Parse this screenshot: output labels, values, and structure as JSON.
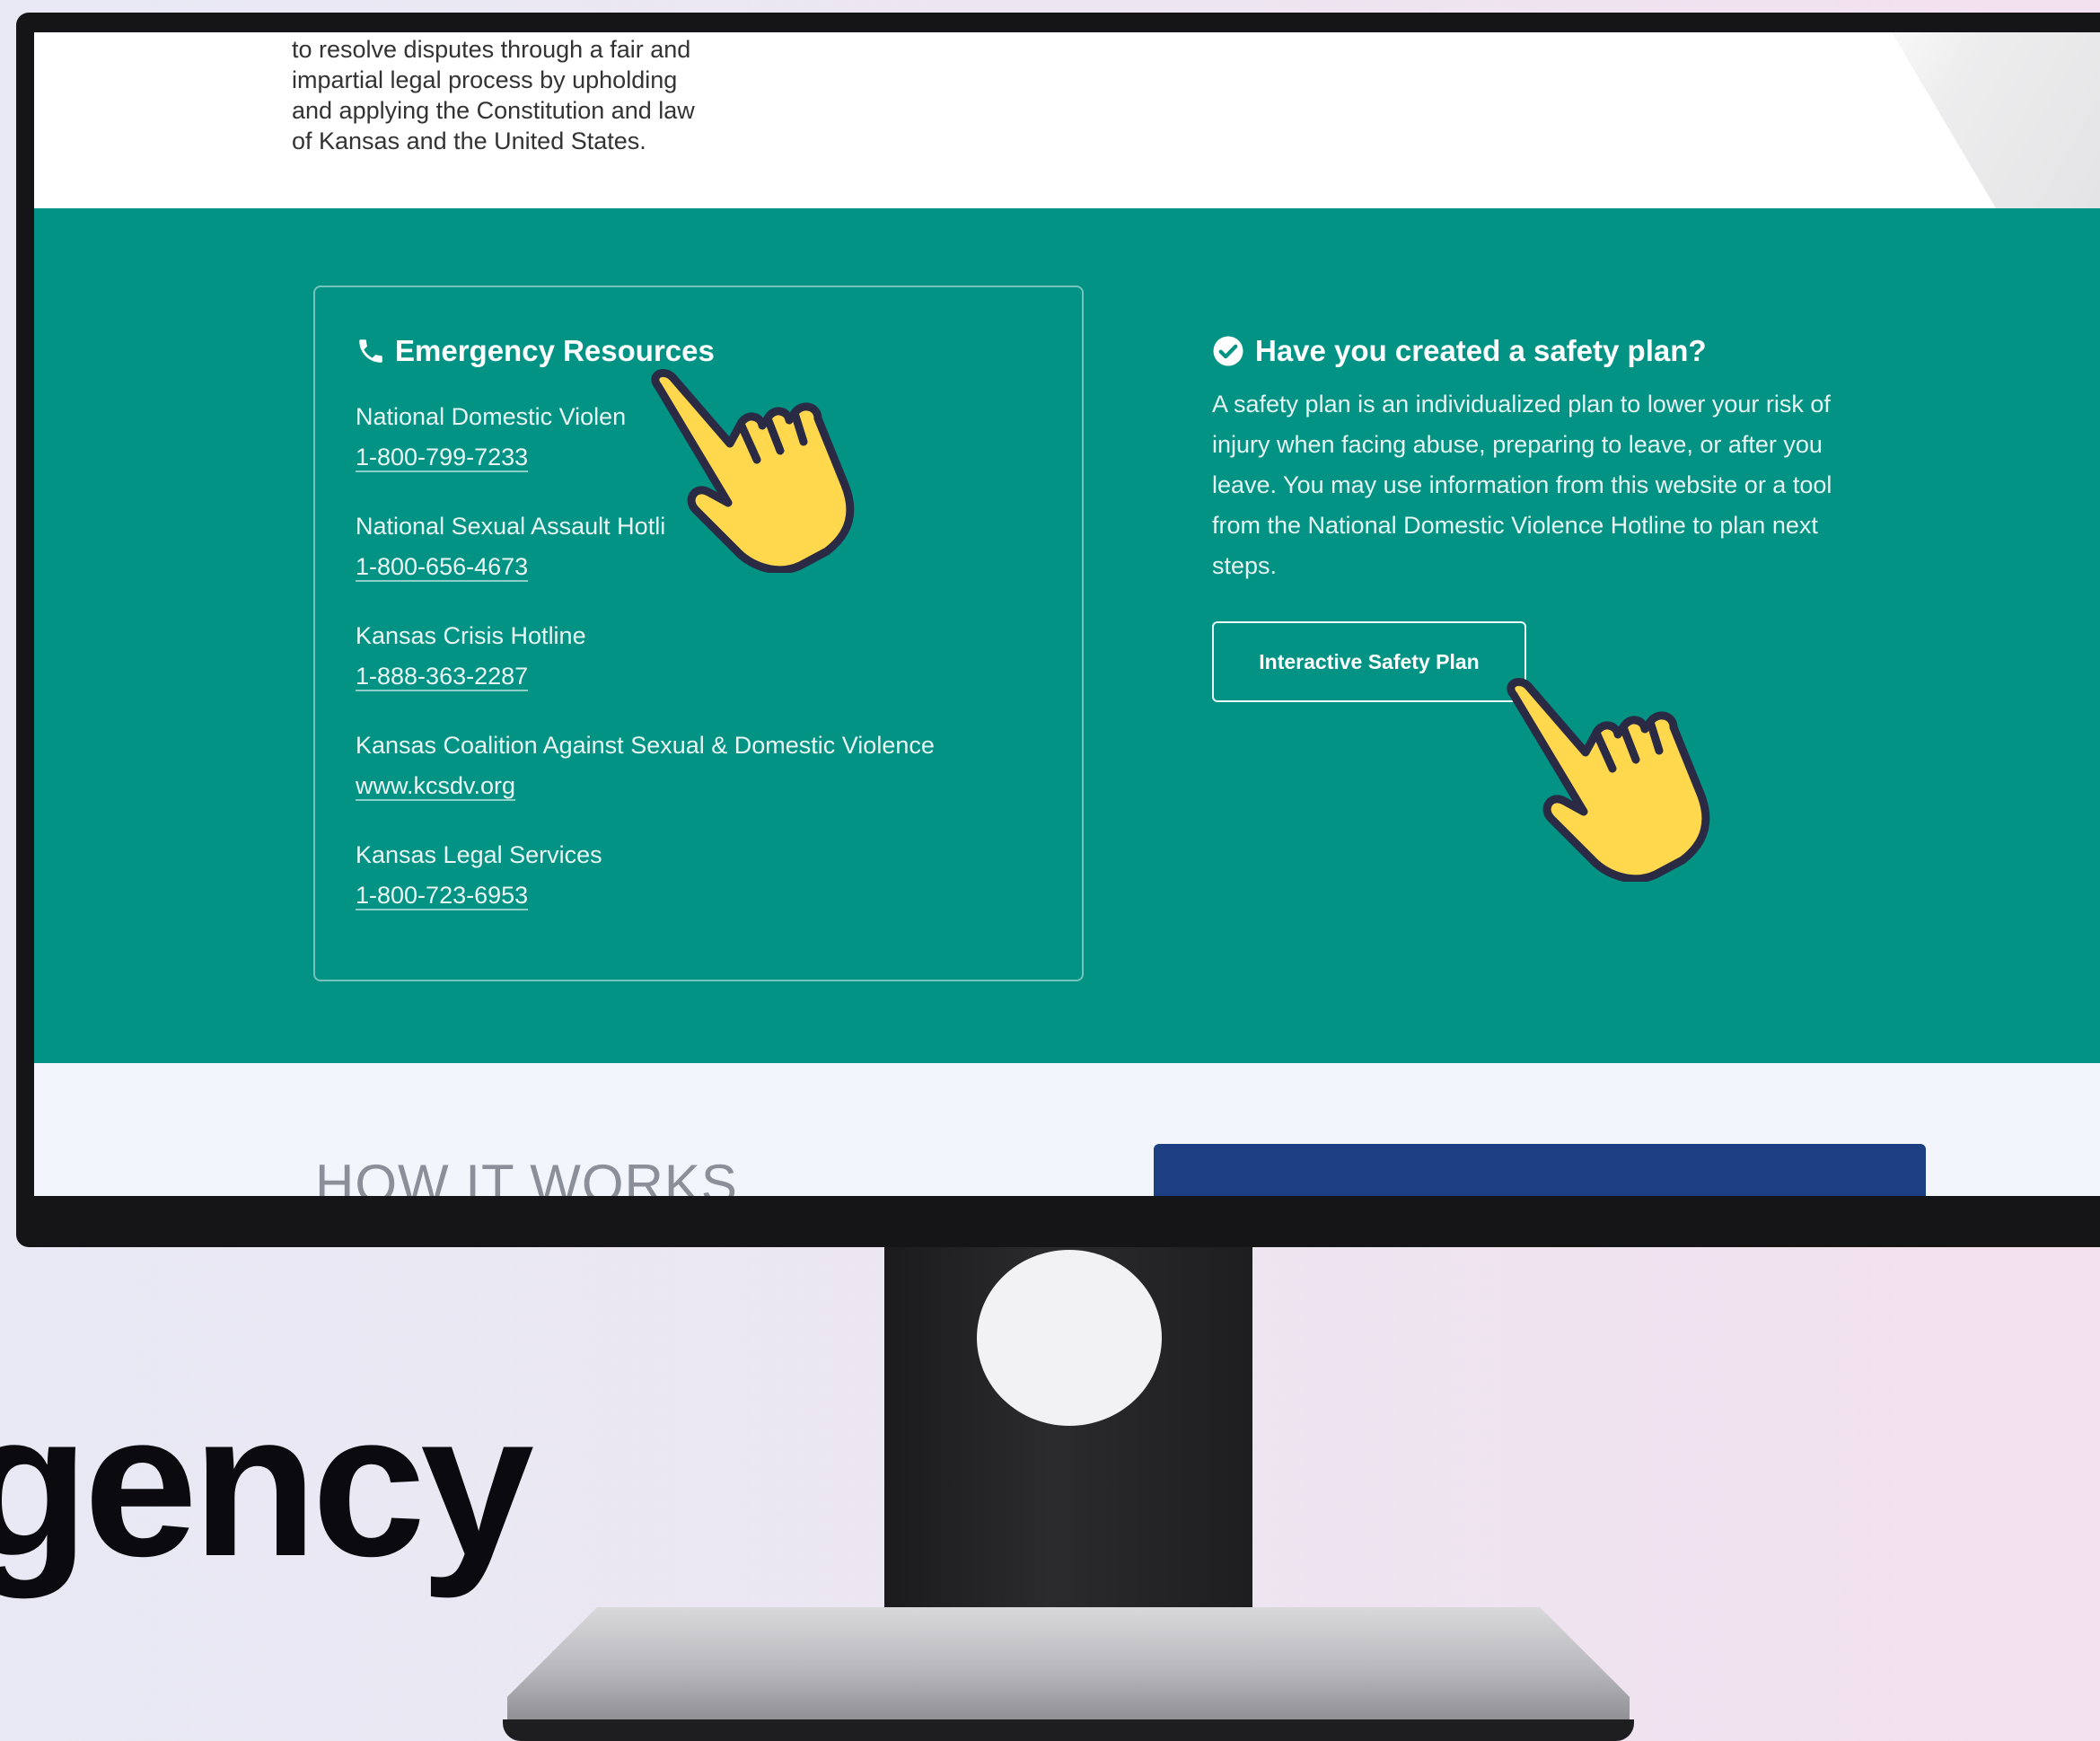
{
  "background_word": "gency",
  "mission_text": "to resolve disputes through a fair and impartial legal process by upholding and applying the Constitution and law of Kansas and the United States.",
  "emergency": {
    "icon": "phone-icon",
    "title": "Emergency Resources",
    "items": [
      {
        "name": "National Domestic Violen",
        "contact": "1-800-799-7233"
      },
      {
        "name": "National Sexual Assault Hotli",
        "contact": "1-800-656-4673"
      },
      {
        "name": "Kansas Crisis Hotline",
        "contact": "1-888-363-2287"
      },
      {
        "name": "Kansas Coalition Against Sexual & Domestic Violence",
        "contact": "www.kcsdv.org"
      },
      {
        "name": "Kansas Legal Services",
        "contact": "1-800-723-6953"
      }
    ]
  },
  "safety_plan": {
    "icon": "check-circle-icon",
    "title": "Have you created a safety plan?",
    "text": "A safety plan is an individualized plan to lower your risk of injury when facing abuse, preparing to leave, or after you leave. You may use information from this website or a tool from the National Domestic Violence Hotline to plan next steps.",
    "button_label": "Interactive Safety Plan"
  },
  "how_it_works_heading": "HOW IT WORKS",
  "colors": {
    "teal": "#029385",
    "navy_card": "#1c3f84",
    "hand_fill": "#ffd84d",
    "hand_outline": "#2b2a45"
  }
}
